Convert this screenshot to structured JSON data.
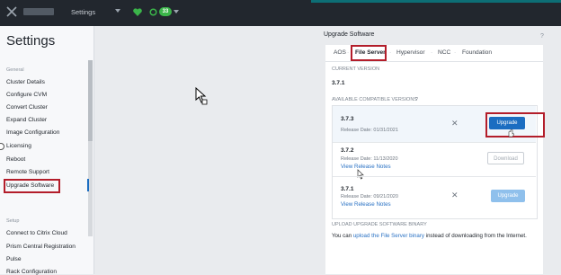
{
  "topbar": {
    "menu_label": "Settings",
    "alert_count": "33",
    "icons": [
      "x-logo-icon",
      "caret-down-icon",
      "heart-health-icon",
      "circle-status-icon"
    ]
  },
  "sidebar": {
    "title": "Settings",
    "section_general": "General",
    "items_general": [
      "Cluster Details",
      "Configure CVM",
      "Convert Cluster",
      "Expand Cluster",
      "Image Configuration",
      "Licensing",
      "Reboot",
      "Remote Support",
      "Upgrade Software"
    ],
    "section_setup": "Setup",
    "items_setup": [
      "Connect to Citrix Cloud",
      "Prism Central Registration",
      "Pulse",
      "Rack Configuration"
    ],
    "active_item": "Upgrade Software"
  },
  "main": {
    "title": "Upgrade Software",
    "help": "?",
    "tabs": [
      "AOS",
      "File Server",
      "Hypervisor",
      "NCC",
      "Foundation"
    ],
    "active_tab": "File Server",
    "tab_separator": "·",
    "current_version_label": "CURRENT VERSION",
    "current_version": "3.7.1",
    "available_label": "AVAILABLE COMPATIBLE VERSIONS",
    "available_help": "?",
    "versions": [
      {
        "version": "3.7.3",
        "release": "Release Date: 01/31/2021",
        "notes": "",
        "action": "Upgrade",
        "dismiss": "✕"
      },
      {
        "version": "3.7.2",
        "release": "Release Date: 11/13/2020",
        "notes": "View Release Notes",
        "action": "Download",
        "dismiss": ""
      },
      {
        "version": "3.7.1",
        "release": "Release Date: 09/21/2020",
        "notes": "View Release Notes",
        "action": "Upgrade",
        "dismiss": "✕"
      }
    ],
    "upload_label": "UPLOAD UPGRADE SOFTWARE BINARY",
    "upload_text_prefix": "You can ",
    "upload_link": "upload the File Server binary",
    "upload_text_suffix": " instead of downloading from the Internet."
  },
  "colors": {
    "accent": "#1b6dc1",
    "highlight": "#b31d2a",
    "topbar": "#22272e",
    "health_green": "#3bb54a"
  }
}
